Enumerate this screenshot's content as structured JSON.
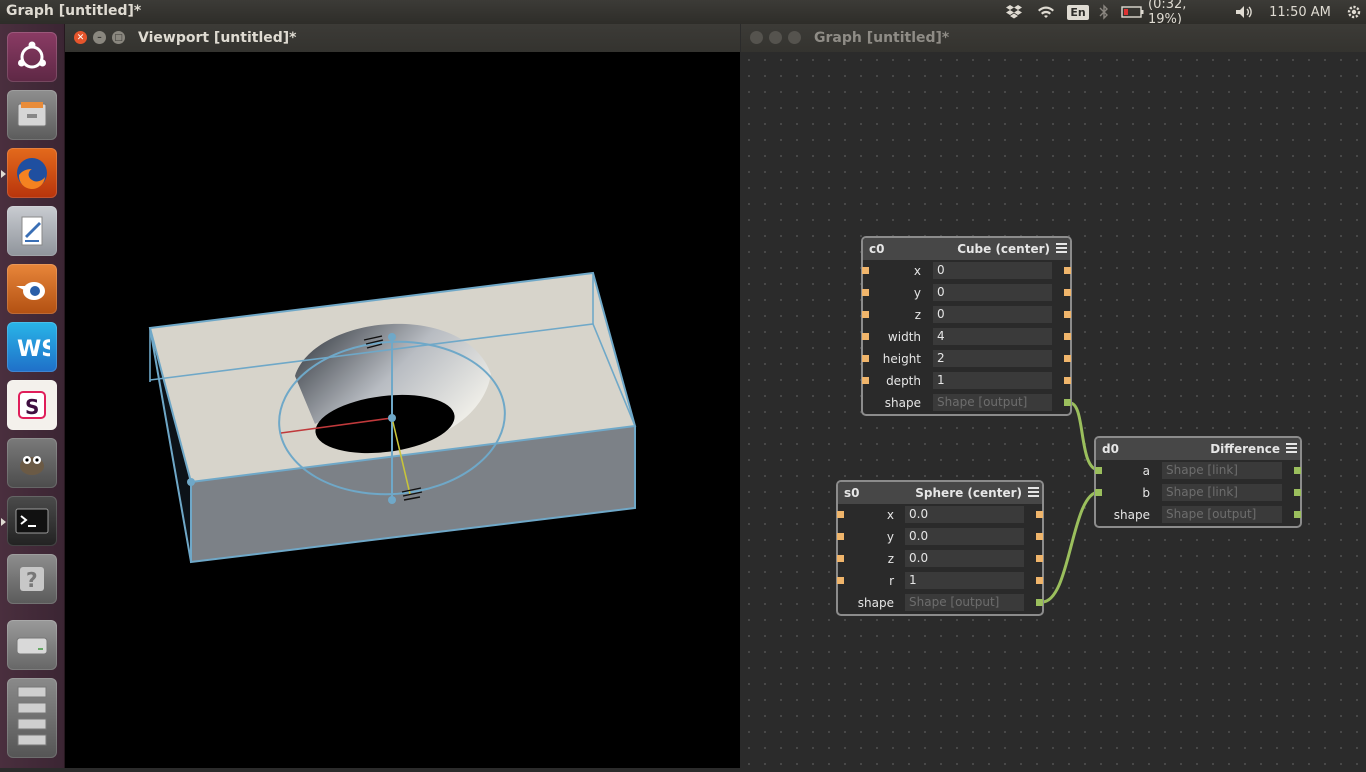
{
  "top_panel": {
    "title": "Graph [untitled]*",
    "lang": "En",
    "battery": "(0:32, 19%)",
    "time": "11:50 AM"
  },
  "launcher": {
    "items": [
      "ubuntu-dash",
      "files",
      "firefox",
      "text-editor",
      "blender",
      "webstorm",
      "slack",
      "gimp",
      "terminal",
      "help",
      "drive",
      "workspaces"
    ]
  },
  "viewport": {
    "title": "Viewport [untitled]*"
  },
  "graph": {
    "title": "Graph [untitled]*",
    "nodes": {
      "cube": {
        "id": "c0",
        "type": "Cube (center)",
        "rows": [
          {
            "label": "x",
            "value": "0"
          },
          {
            "label": "y",
            "value": "0"
          },
          {
            "label": "z",
            "value": "0"
          },
          {
            "label": "width",
            "value": "4"
          },
          {
            "label": "height",
            "value": "2"
          },
          {
            "label": "depth",
            "value": "1"
          },
          {
            "label": "shape",
            "value": "Shape [output]"
          }
        ]
      },
      "sphere": {
        "id": "s0",
        "type": "Sphere (center)",
        "rows": [
          {
            "label": "x",
            "value": "0.0"
          },
          {
            "label": "y",
            "value": "0.0"
          },
          {
            "label": "z",
            "value": "0.0"
          },
          {
            "label": "r",
            "value": "1"
          },
          {
            "label": "shape",
            "value": "Shape [output]"
          }
        ]
      },
      "difference": {
        "id": "d0",
        "type": "Difference",
        "rows": [
          {
            "label": "a",
            "value": "Shape [link]"
          },
          {
            "label": "b",
            "value": "Shape [link]"
          },
          {
            "label": "shape",
            "value": "Shape [output]"
          }
        ]
      }
    }
  },
  "colors": {
    "port": "#f0b56b",
    "link": "#9bbf5d",
    "wire": "#6fa8c8"
  }
}
